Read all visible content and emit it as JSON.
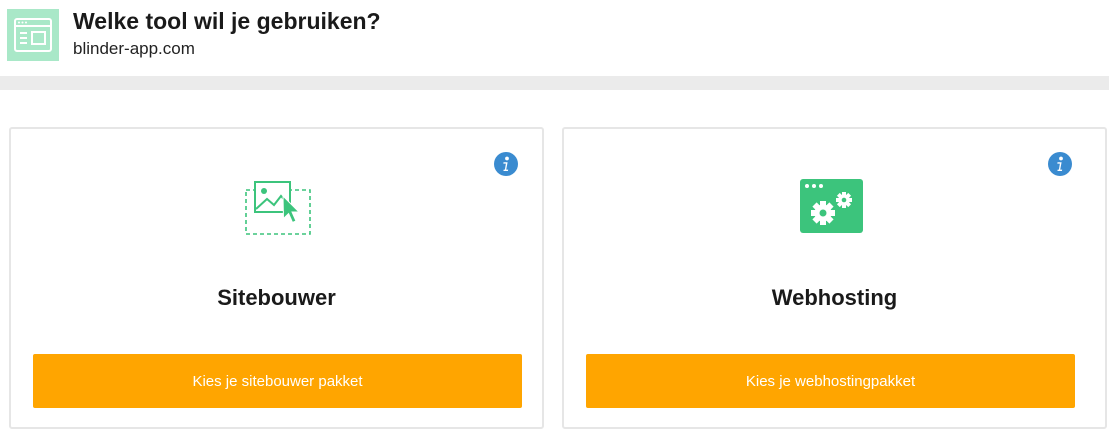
{
  "header": {
    "title": "Welke tool wil je gebruiken?",
    "subtitle": "blinder-app.com",
    "icon": "browser-window-icon"
  },
  "colors": {
    "accent_green": "#3cc47c",
    "button_orange": "#ffa500",
    "info_blue": "#3a8bd0"
  },
  "cards": [
    {
      "title": "Sitebouwer",
      "icon": "image-cursor-icon",
      "button_label": "Kies je sitebouwer pakket"
    },
    {
      "title": "Webhosting",
      "icon": "browser-gears-icon",
      "button_label": "Kies je webhostingpakket"
    }
  ]
}
